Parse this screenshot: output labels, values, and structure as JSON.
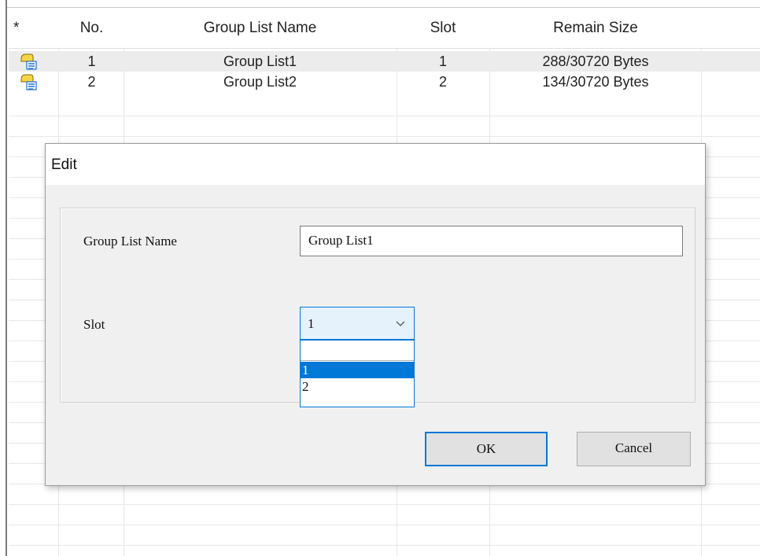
{
  "table": {
    "columns": [
      "*",
      "No.",
      "Group List Name",
      "Slot",
      "Remain Size"
    ],
    "rows": [
      {
        "icon": "group-list-icon",
        "no": "1",
        "name": "Group List1",
        "slot": "1",
        "remain": "288/30720 Bytes"
      },
      {
        "icon": "group-list-icon",
        "no": "2",
        "name": "Group List2",
        "slot": "2",
        "remain": "134/30720 Bytes"
      }
    ]
  },
  "dialog": {
    "title": "Edit",
    "name_label": "Group List Name",
    "name_value": "Group List1",
    "slot_label": "Slot",
    "slot_value": "1",
    "slot_options": [
      "",
      "1",
      "2"
    ],
    "slot_selected_option": "1",
    "ok_label": "OK",
    "cancel_label": "Cancel"
  },
  "colors": {
    "accent": "#0078d7",
    "icon_yellow": "#f5d547",
    "icon_blue": "#1f6fd1",
    "alt_row": "#ececec"
  }
}
